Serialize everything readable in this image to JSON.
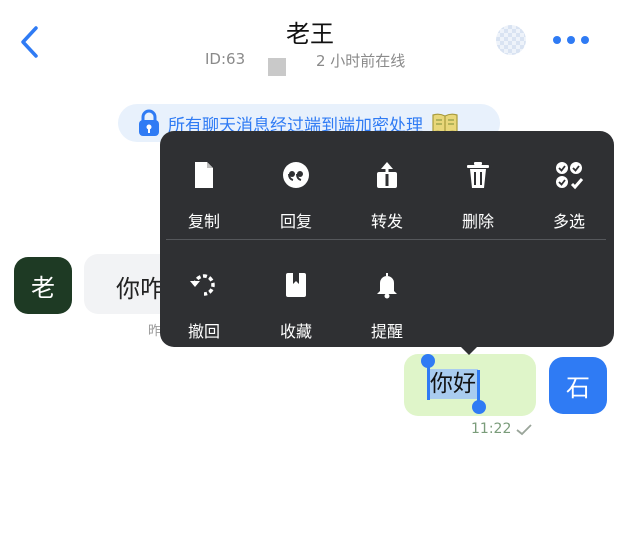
{
  "header": {
    "title": "老王",
    "id_label": "ID:63",
    "online_status": "2 小时前在线"
  },
  "banner": {
    "text": "所有聊天消息经过端到端加密处理"
  },
  "incoming": {
    "avatar_text": "老",
    "message": "你咋",
    "time": "昨"
  },
  "outgoing": {
    "avatar_text": "石",
    "message": "你好",
    "time": "11:22"
  },
  "menu": {
    "row1": [
      {
        "label": "复制",
        "icon": "copy-icon"
      },
      {
        "label": "回复",
        "icon": "quote-icon"
      },
      {
        "label": "转发",
        "icon": "share-icon"
      },
      {
        "label": "删除",
        "icon": "trash-icon"
      },
      {
        "label": "多选",
        "icon": "multi-select-icon"
      }
    ],
    "row2": [
      {
        "label": "撤回",
        "icon": "recall-icon"
      },
      {
        "label": "收藏",
        "icon": "bookmark-icon"
      },
      {
        "label": "提醒",
        "icon": "bell-icon"
      }
    ]
  },
  "colors": {
    "accent": "#2f7bf4",
    "menu_bg": "#2f3033",
    "outgoing_bubble": "#dff5c9",
    "incoming_bubble": "#f2f3f5",
    "lao_avatar": "#1e3a24"
  }
}
